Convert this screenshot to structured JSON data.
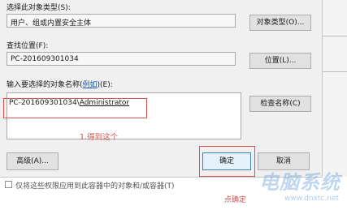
{
  "dialog": {
    "object_type_label": "选择此对象类型(S):",
    "object_type_value": "用户、组或内置安全主体",
    "object_type_button": "对象类型(O)...",
    "location_label": "查找位置(F):",
    "location_value": "PC-201609301034",
    "location_button": "位置(L)...",
    "names_label_prefix": "输入要选择的对象名称(",
    "names_label_link": "例如",
    "names_label_suffix": ")(E):",
    "entered_name_host": "PC-201609301034\\",
    "entered_name_user": "Administrator",
    "check_names_button": "检查名称(C)",
    "advanced_button": "高级(A)...",
    "ok_button": "确定",
    "cancel_button": "取消"
  },
  "annotations": {
    "step1_note": "1.得到这个",
    "step2_note": "点确定"
  },
  "background": {
    "inherit_checkbox_label": "仅将这些权限应用到此容器中的对象和/或容器(T)",
    "inherit_checked": false
  },
  "watermark": {
    "brand": "电脑系统",
    "url": "www.dnxtc.net"
  },
  "colors": {
    "annotation_red": "#d9534f",
    "dialog_bg": "#f0f0f0",
    "link_blue": "#1a5fb4"
  }
}
